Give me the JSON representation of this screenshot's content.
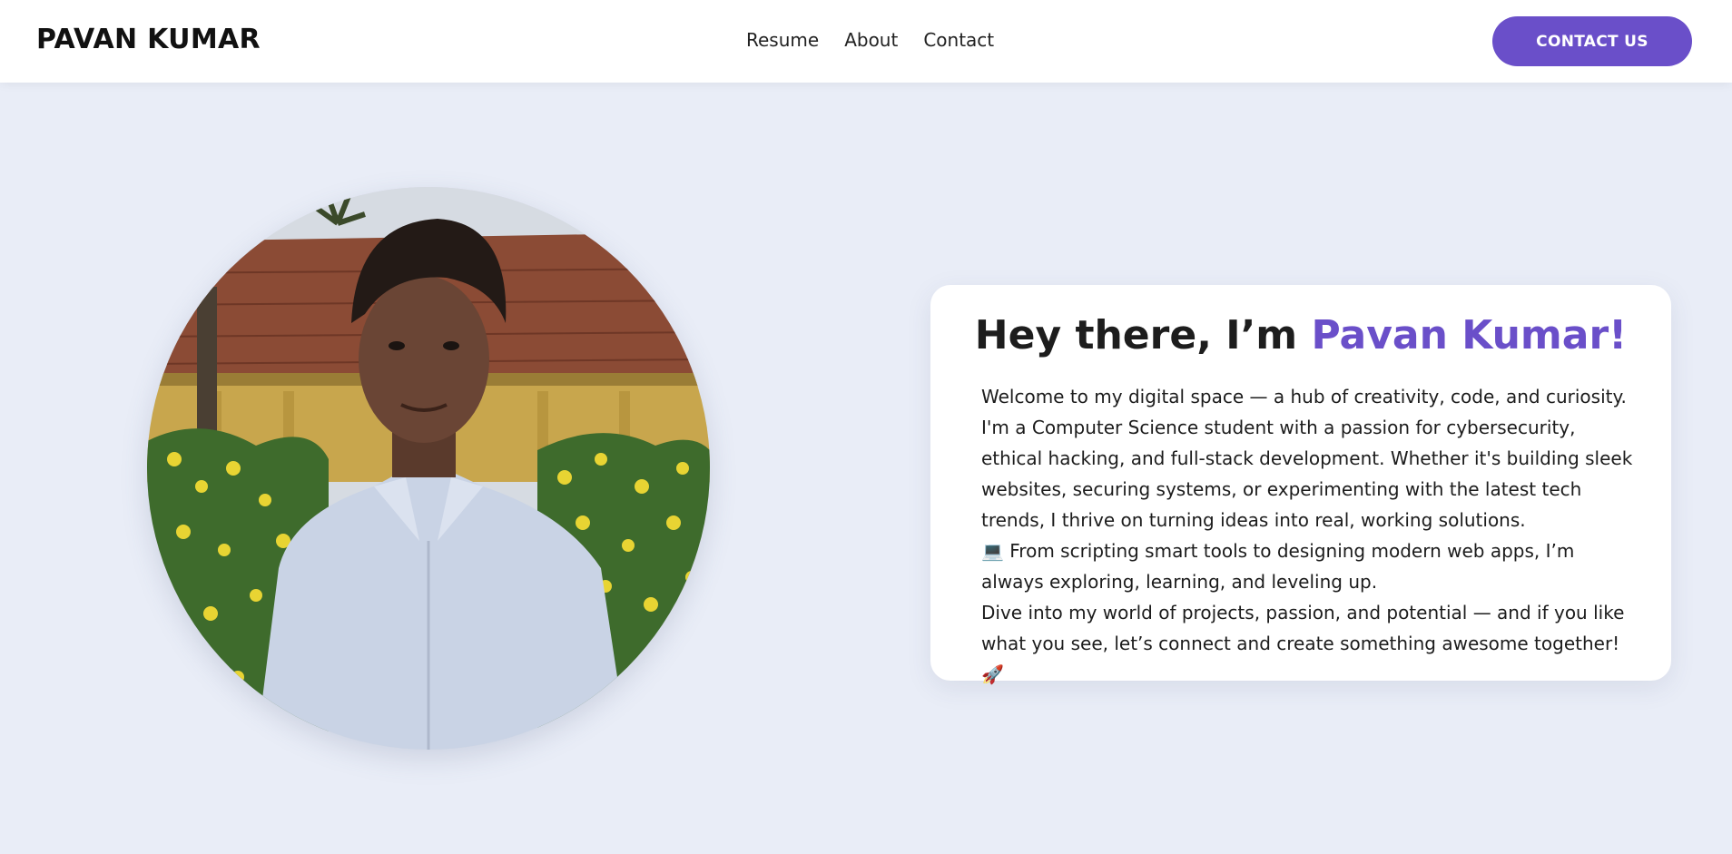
{
  "header": {
    "brand": "PAVAN KUMAR",
    "nav": [
      {
        "label": "Resume"
      },
      {
        "label": "About"
      },
      {
        "label": "Contact"
      }
    ],
    "cta_label": "CONTACT US"
  },
  "hero": {
    "photo_alt": "Profile photo",
    "heading_prefix": "Hey there, I’m ",
    "heading_name": "Pavan Kumar!",
    "paragraphs": [
      "Welcome to my digital space — a hub of creativity, code, and curiosity.",
      "I'm a Computer Science student with a passion for cybersecurity, ethical hacking, and full-stack development. Whether it's building sleek websites, securing systems, or experimenting with the latest tech trends, I thrive on turning ideas into real, working solutions.",
      "💻 From scripting smart tools to designing modern web apps, I’m always exploring, learning, and leveling up.",
      "Dive into my world of projects, passion, and potential — and if you like what you see, let’s connect and create something awesome together! 🚀"
    ]
  },
  "colors": {
    "accent": "#6a4fc9",
    "page_background": "#e9edf7",
    "card_background": "#ffffff"
  }
}
